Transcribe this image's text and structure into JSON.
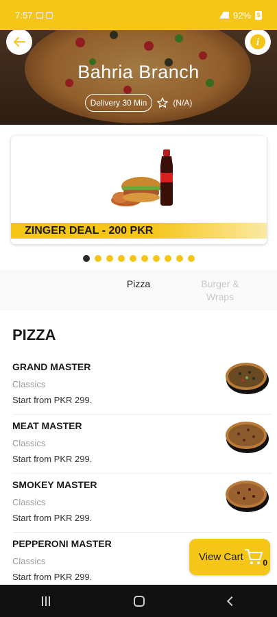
{
  "status_bar": {
    "time": "7:57",
    "battery": "92%"
  },
  "header": {
    "title": "Bahria Branch",
    "delivery": "Delivery 30 Min",
    "rating": "(N/A)"
  },
  "banner": {
    "deal_label": "ZINGER DEAL - 200 PKR",
    "slide_count": 10,
    "active_slide": 1
  },
  "tabs": [
    {
      "label": "Pizza",
      "active": true
    },
    {
      "label": "Burger & Wraps",
      "active": false
    }
  ],
  "section": {
    "title": "PIZZA"
  },
  "items": [
    {
      "name": "GRAND MASTER",
      "category": "Classics",
      "price": "Start from PKR 299."
    },
    {
      "name": "MEAT MASTER",
      "category": "Classics",
      "price": "Start from PKR 299."
    },
    {
      "name": "SMOKEY MASTER",
      "category": "Classics",
      "price": "Start from PKR 299."
    },
    {
      "name": "PEPPERONI MASTER",
      "category": "Classics",
      "price": "Start from PKR 299."
    }
  ],
  "cart": {
    "label": "View Cart",
    "count": "0"
  },
  "colors": {
    "accent": "#f5c518",
    "nav": "#111111"
  },
  "icons": [
    "back-arrow-icon",
    "info-icon",
    "star-icon",
    "cart-icon"
  ]
}
